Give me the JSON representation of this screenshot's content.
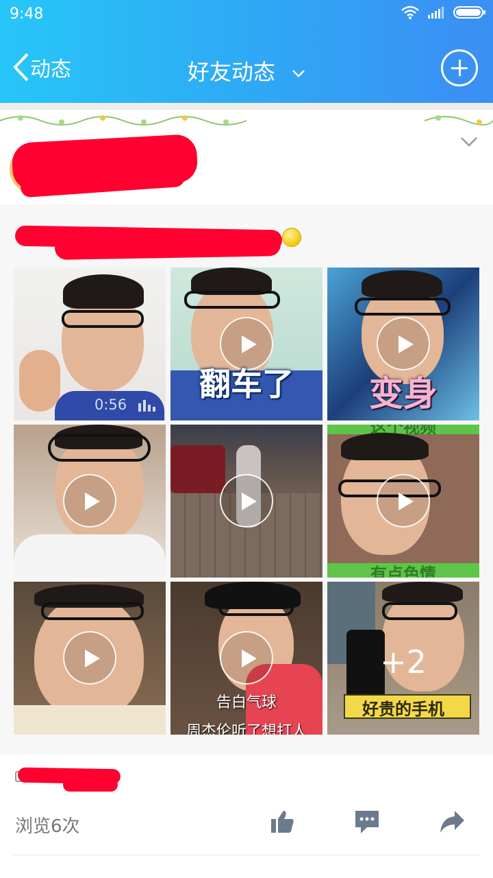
{
  "status_bar": {
    "time": "9:48"
  },
  "nav": {
    "back_label": "动态",
    "title": "好友动态"
  },
  "tiles": [
    {
      "duration": "0:56"
    },
    {
      "caption": "翻车了"
    },
    {
      "caption": "变身"
    },
    {
      "caption_top": "这个视频",
      "caption_bottom": "有点色情"
    },
    {},
    {},
    {},
    {
      "caption": "告白气球",
      "caption_bottom": "周杰伦听了想打人"
    },
    {
      "caption": "好贵的手机",
      "more": "+2"
    }
  ],
  "footer": {
    "views": "浏览6次"
  }
}
